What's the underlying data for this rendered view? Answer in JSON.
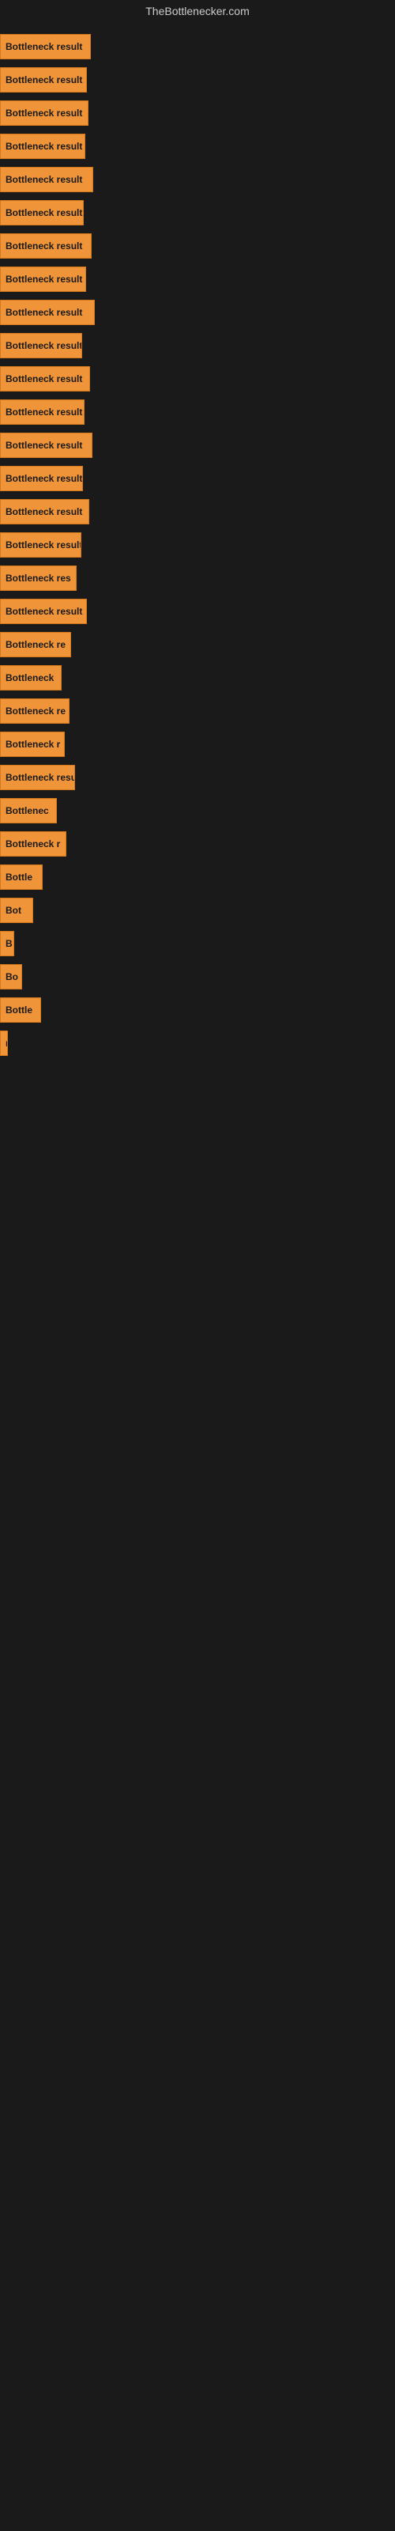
{
  "site_title": "TheBottlenecker.com",
  "bars": [
    {
      "label": "Bottleneck result",
      "width": 115
    },
    {
      "label": "Bottleneck result",
      "width": 110
    },
    {
      "label": "Bottleneck result",
      "width": 112
    },
    {
      "label": "Bottleneck result",
      "width": 108
    },
    {
      "label": "Bottleneck result",
      "width": 118
    },
    {
      "label": "Bottleneck result",
      "width": 106
    },
    {
      "label": "Bottleneck result",
      "width": 116
    },
    {
      "label": "Bottleneck result",
      "width": 109
    },
    {
      "label": "Bottleneck result",
      "width": 120
    },
    {
      "label": "Bottleneck result",
      "width": 104
    },
    {
      "label": "Bottleneck result",
      "width": 114
    },
    {
      "label": "Bottleneck result",
      "width": 107
    },
    {
      "label": "Bottleneck result",
      "width": 117
    },
    {
      "label": "Bottleneck result",
      "width": 105
    },
    {
      "label": "Bottleneck result",
      "width": 113
    },
    {
      "label": "Bottleneck result",
      "width": 103
    },
    {
      "label": "Bottleneck res",
      "width": 97
    },
    {
      "label": "Bottleneck result",
      "width": 110
    },
    {
      "label": "Bottleneck re",
      "width": 90
    },
    {
      "label": "Bottleneck",
      "width": 78
    },
    {
      "label": "Bottleneck re",
      "width": 88
    },
    {
      "label": "Bottleneck r",
      "width": 82
    },
    {
      "label": "Bottleneck resu",
      "width": 95
    },
    {
      "label": "Bottlenec",
      "width": 72
    },
    {
      "label": "Bottleneck r",
      "width": 84
    },
    {
      "label": "Bottle",
      "width": 54
    },
    {
      "label": "Bot",
      "width": 42
    },
    {
      "label": "B",
      "width": 18
    },
    {
      "label": "Bo",
      "width": 28
    },
    {
      "label": "Bottle",
      "width": 52
    },
    {
      "label": "n",
      "width": 10
    }
  ]
}
